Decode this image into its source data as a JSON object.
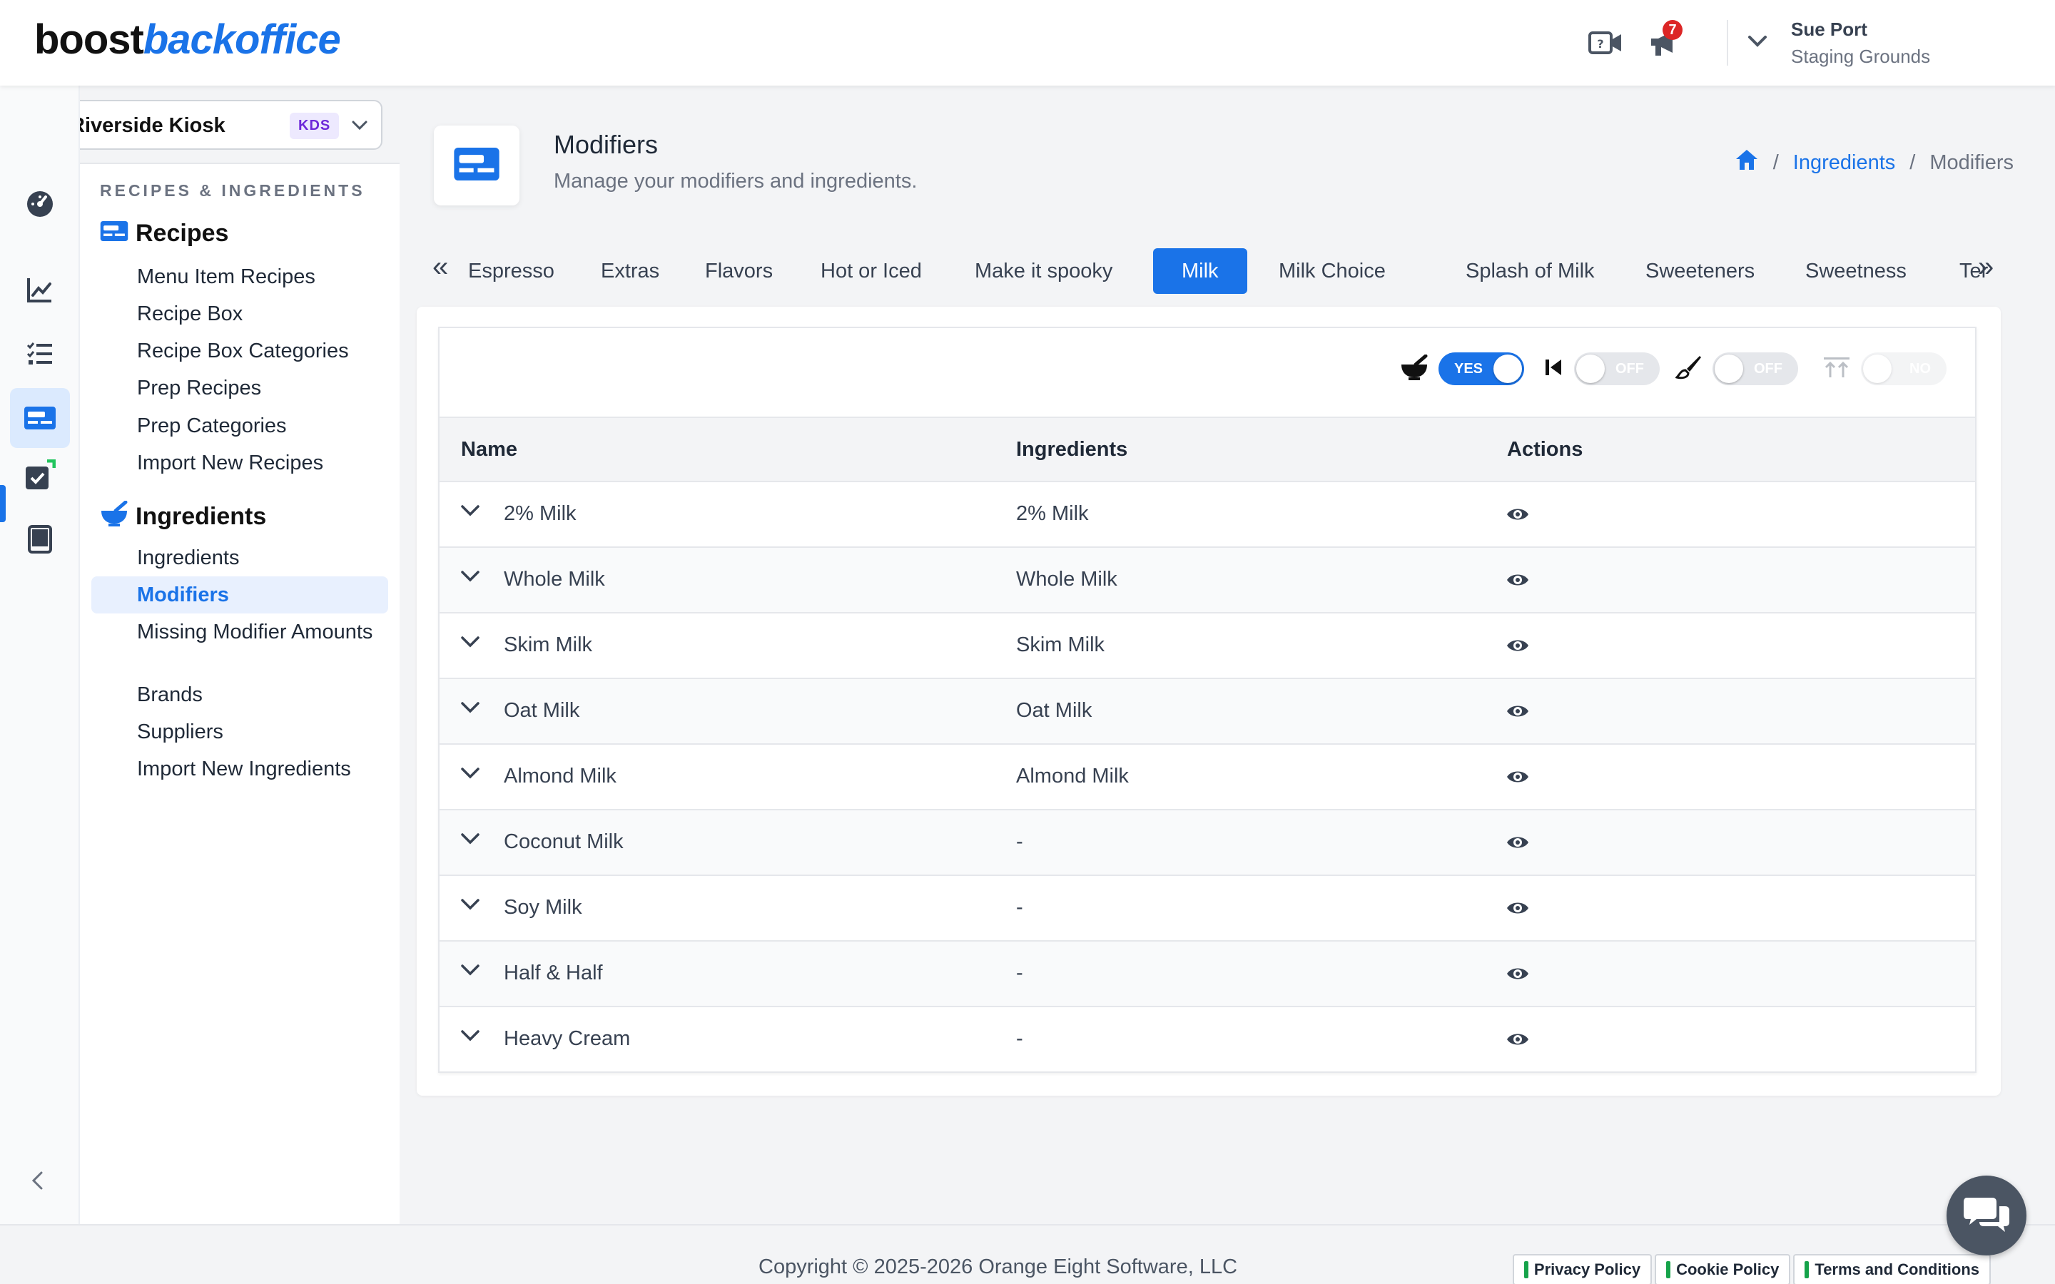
{
  "header": {
    "logo_part1": "boost",
    "logo_part2": "backoffice",
    "notification_count": "7",
    "user_name": "Sue Port",
    "user_org": "Staging Grounds"
  },
  "location": {
    "name": "Riverside Kiosk",
    "tag": "KDS"
  },
  "submenu": {
    "section_label": "RECIPES & INGREDIENTS",
    "groups": [
      {
        "title": "Recipes",
        "items": [
          "Menu Item Recipes",
          "Recipe Box",
          "Recipe Box Categories",
          "Prep Recipes",
          "Prep Categories",
          "Import New Recipes"
        ]
      },
      {
        "title": "Ingredients",
        "items": [
          "Ingredients",
          "Modifiers",
          "Missing Modifier Amounts",
          "Brands",
          "Suppliers",
          "Import New Ingredients"
        ]
      }
    ],
    "active_item": "Modifiers"
  },
  "page": {
    "title": "Modifiers",
    "subtitle": "Manage your modifiers and ingredients."
  },
  "breadcrumb": {
    "items": [
      "Ingredients",
      "Modifiers"
    ],
    "separator": "/"
  },
  "tabs": {
    "items": [
      "Espresso",
      "Extras",
      "Flavors",
      "Hot or Iced",
      "Make it spooky",
      "Milk",
      "Milk Choice",
      "Splash of Milk",
      "Sweeteners",
      "Sweetness",
      "Ter"
    ],
    "active": "Milk",
    "prev_glyph": "«",
    "next_glyph": "»"
  },
  "toolbar": {
    "toggles": [
      {
        "icon": "mortar-pestle-icon",
        "state": "YES",
        "on": true
      },
      {
        "icon": "skip-back-icon",
        "state": "OFF",
        "on": false
      },
      {
        "icon": "brush-icon",
        "state": "OFF",
        "on": false
      },
      {
        "icon": "sort-top-icon",
        "state": "NO",
        "on": false
      }
    ]
  },
  "table": {
    "columns": [
      "Name",
      "Ingredients",
      "Actions"
    ],
    "rows": [
      {
        "name": "2% Milk",
        "ingredients": "2% Milk"
      },
      {
        "name": "Whole Milk",
        "ingredients": "Whole Milk"
      },
      {
        "name": "Skim Milk",
        "ingredients": "Skim Milk"
      },
      {
        "name": "Oat Milk",
        "ingredients": "Oat Milk"
      },
      {
        "name": "Almond Milk",
        "ingredients": "Almond Milk"
      },
      {
        "name": "Coconut Milk",
        "ingredients": "-"
      },
      {
        "name": "Soy Milk",
        "ingredients": "-"
      },
      {
        "name": "Half & Half",
        "ingredients": "-"
      },
      {
        "name": "Heavy Cream",
        "ingredients": "-"
      }
    ]
  },
  "footer": {
    "copyright": "Copyright © 2025-2026 Orange Eight Software, LLC",
    "links": [
      "Privacy Policy",
      "Cookie Policy",
      "Terms and Conditions"
    ]
  },
  "colors": {
    "accent": "#1a73e8",
    "badge": "#dc2626",
    "footer_link_bar": "#16a34a"
  }
}
